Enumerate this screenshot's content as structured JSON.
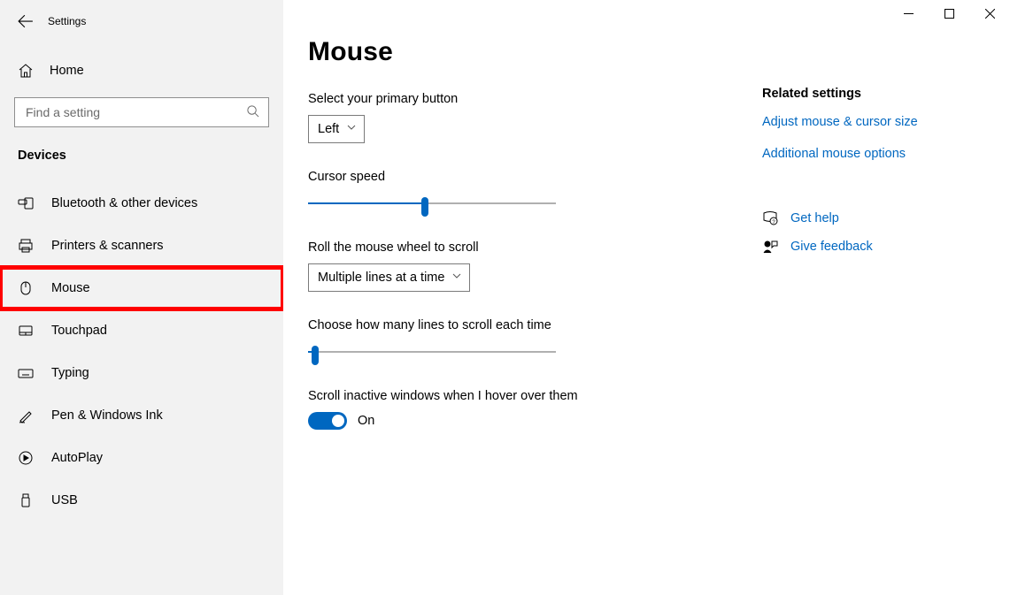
{
  "app_title": "Settings",
  "search_placeholder": "Find a setting",
  "home_label": "Home",
  "section_label": "Devices",
  "sidebar_items": [
    {
      "label": "Bluetooth & other devices"
    },
    {
      "label": "Printers & scanners"
    },
    {
      "label": "Mouse"
    },
    {
      "label": "Touchpad"
    },
    {
      "label": "Typing"
    },
    {
      "label": "Pen & Windows Ink"
    },
    {
      "label": "AutoPlay"
    },
    {
      "label": "USB"
    }
  ],
  "page": {
    "title": "Mouse",
    "primary_button_label": "Select your primary button",
    "primary_button_value": "Left",
    "cursor_speed_label": "Cursor speed",
    "cursor_speed_pct": 47,
    "wheel_label": "Roll the mouse wheel to scroll",
    "wheel_value": "Multiple lines at a time",
    "lines_label": "Choose how many lines to scroll each time",
    "lines_pct": 3,
    "inactive_label": "Scroll inactive windows when I hover over them",
    "inactive_toggle_text": "On"
  },
  "rail": {
    "heading": "Related settings",
    "link1": "Adjust mouse & cursor size",
    "link2": "Additional mouse options",
    "help": "Get help",
    "feedback": "Give feedback"
  }
}
